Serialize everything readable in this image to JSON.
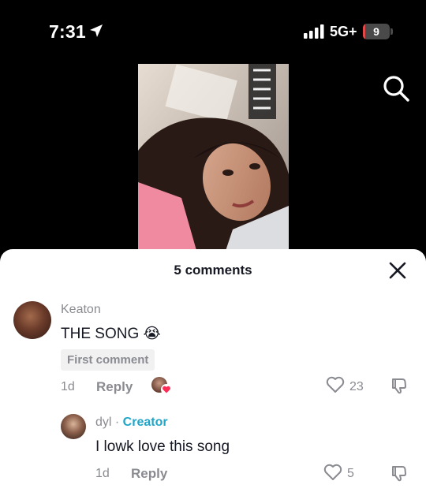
{
  "status_bar": {
    "time": "7:31",
    "location_icon": "location-arrow-icon",
    "signal_icon": "cellular-signal-icon",
    "network": "5G+",
    "battery_level": "9",
    "battery_fraction": 0.09,
    "battery_color": "#e34646"
  },
  "video": {
    "search_icon": "search-icon"
  },
  "comments": {
    "title": "5 comments",
    "close_icon": "close-icon",
    "items": [
      {
        "username": "Keaton",
        "text": "THE SONG 😭",
        "badge": "First comment",
        "age": "1d",
        "reply_label": "Reply",
        "likes": "23",
        "creator_liked": true
      },
      {
        "username": "dyl",
        "separator": " · ",
        "role": "Creator",
        "text": "I lowk love this song",
        "age": "1d",
        "reply_label": "Reply",
        "likes": "5"
      }
    ]
  },
  "colors": {
    "creator_accent": "#20a6c8",
    "heart_red": "#fe2c55",
    "text_secondary": "#8a8b91"
  }
}
